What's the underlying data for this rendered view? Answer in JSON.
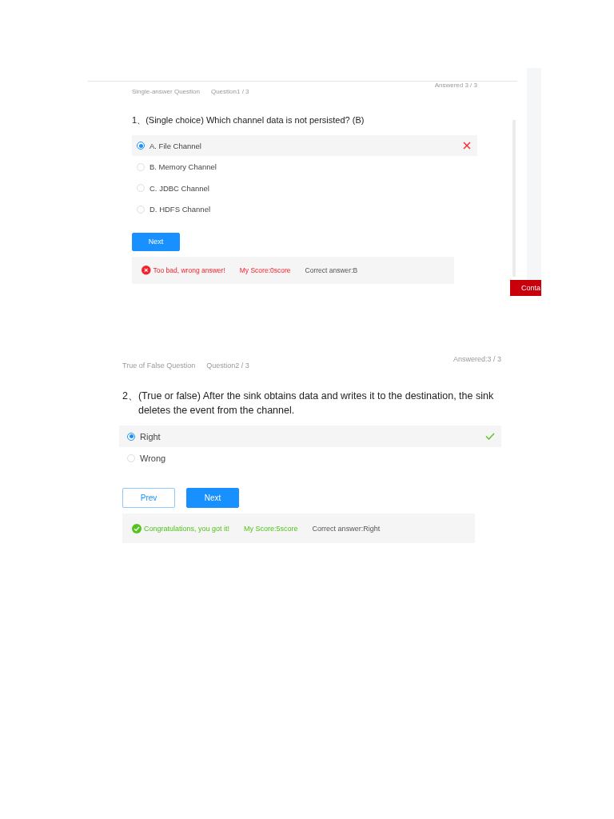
{
  "panels": [
    {
      "question_type": "Single-answer Question",
      "question_no": "Question1 / 3",
      "answered": "Answered 3 / 3",
      "number": "1、",
      "question": "(Single choice) Which channel data is not persisted? (B)",
      "options": [
        {
          "label": "A. File Channel",
          "selected": true,
          "cross": true,
          "tick": false
        },
        {
          "label": "B. Memory Channel",
          "selected": false,
          "cross": false,
          "tick": false
        },
        {
          "label": "C. JDBC Channel",
          "selected": false,
          "cross": false,
          "tick": false
        },
        {
          "label": "D. HDFS Channel",
          "selected": false,
          "cross": false,
          "tick": false
        }
      ],
      "buttons": [
        {
          "label": "Next",
          "kind": "primary"
        }
      ],
      "feedback": {
        "correct": false,
        "message": "Too bad, wrong answer!",
        "score": "My Score:0score",
        "correct_answer": "Correct answer:B"
      },
      "side_button": "Conta"
    },
    {
      "question_type": "True of False Question",
      "question_no": "Question2 / 3",
      "answered": "Answered:3 / 3",
      "number": "2、",
      "question": "(True or false) After the sink obtains data and writes it to the destination, the sink deletes the event from the channel.",
      "options": [
        {
          "label": "Right",
          "selected": true,
          "cross": false,
          "tick": true
        },
        {
          "label": "Wrong",
          "selected": false,
          "cross": false,
          "tick": false
        }
      ],
      "buttons": [
        {
          "label": "Prev",
          "kind": "outline"
        },
        {
          "label": "Next",
          "kind": "primary"
        }
      ],
      "feedback": {
        "correct": true,
        "message": "Congratulations, you got it!",
        "score": "My Score:5score",
        "correct_answer": "Correct answer:Right"
      }
    }
  ]
}
